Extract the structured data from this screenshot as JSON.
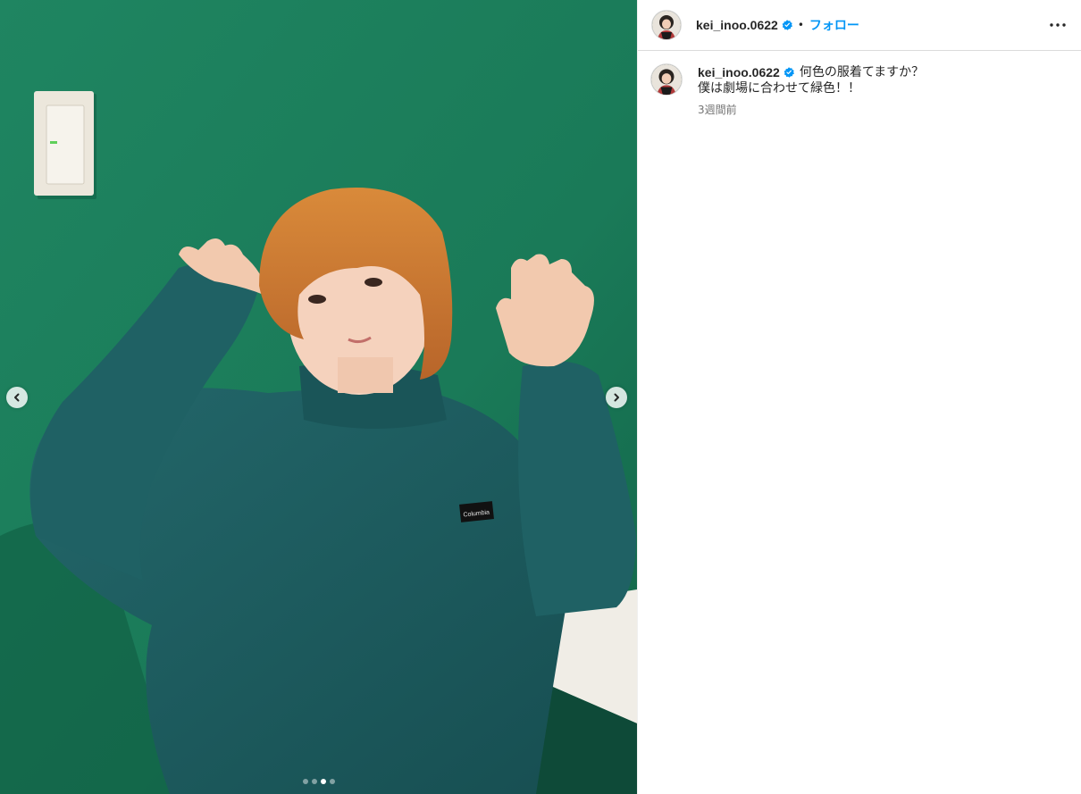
{
  "post": {
    "username": "kei_inoo.0622",
    "separator": "•",
    "follow_label": "フォロー",
    "more_icon": "more-horizontal-icon",
    "verified_icon": "verified-badge-icon",
    "verified_color": "#0095f6",
    "caption": {
      "username": "kei_inoo.0622",
      "line1": "何色の服着てますか？",
      "line2": "僕は劇場に合わせて緑色！！",
      "timestamp": "3週間前"
    }
  },
  "media": {
    "prev_icon": "chevron-left-icon",
    "next_icon": "chevron-right-icon",
    "slide_count": 4,
    "active_slide": 3,
    "photo_text": "Columbia"
  },
  "colors": {
    "wall": "#1b7e5c",
    "sweater": "#1f5e5e",
    "hair": "#c9782f",
    "link": "#0095f6"
  }
}
